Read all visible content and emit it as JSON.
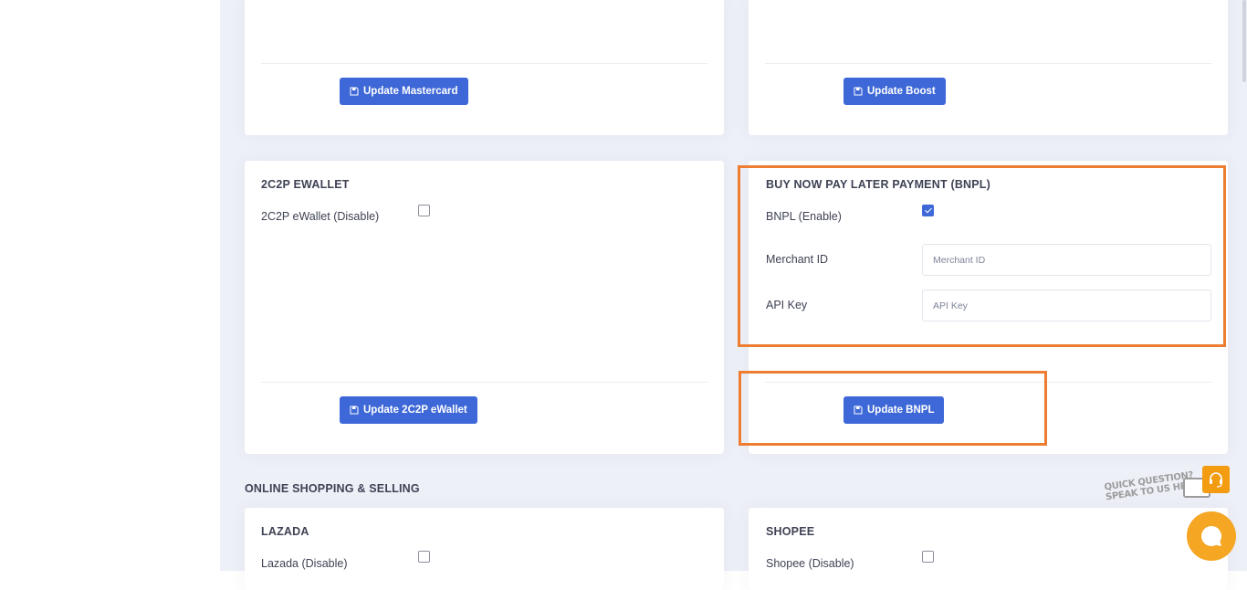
{
  "cards": {
    "mastercard": {
      "button": "Update Mastercard"
    },
    "boost": {
      "button": "Update Boost"
    },
    "ewallet": {
      "title": "2C2P EWALLET",
      "toggle_label": "2C2P eWallet (Disable)",
      "checked": false,
      "button": "Update 2C2P eWallet"
    },
    "bnpl": {
      "title": "BUY NOW PAY LATER PAYMENT (BNPL)",
      "toggle_label": "BNPL (Enable)",
      "checked": true,
      "merchant_id_label": "Merchant ID",
      "merchant_id_placeholder": "Merchant ID",
      "merchant_id_value": "",
      "api_key_label": "API Key",
      "api_key_placeholder": "API Key",
      "api_key_value": "",
      "button": "Update BNPL"
    }
  },
  "online_section": {
    "title": "ONLINE SHOPPING & SELLING",
    "lazada": {
      "title": "LAZADA",
      "toggle_label": "Lazada (Disable)",
      "checked": false
    },
    "shopee": {
      "title": "SHOPEE",
      "toggle_label": "Shopee (Disable)",
      "checked": false
    }
  },
  "help_widget": {
    "line1": "QUICK QUESTION?",
    "line2": "SPEAK TO US HERE!"
  },
  "icons": {
    "save": "save-icon",
    "headset": "headset-icon",
    "chat": "chat-icon"
  },
  "colors": {
    "primary": "#3e68d7",
    "highlight": "#ed7d31",
    "chat": "#f5a623",
    "background": "#eef0f8"
  }
}
